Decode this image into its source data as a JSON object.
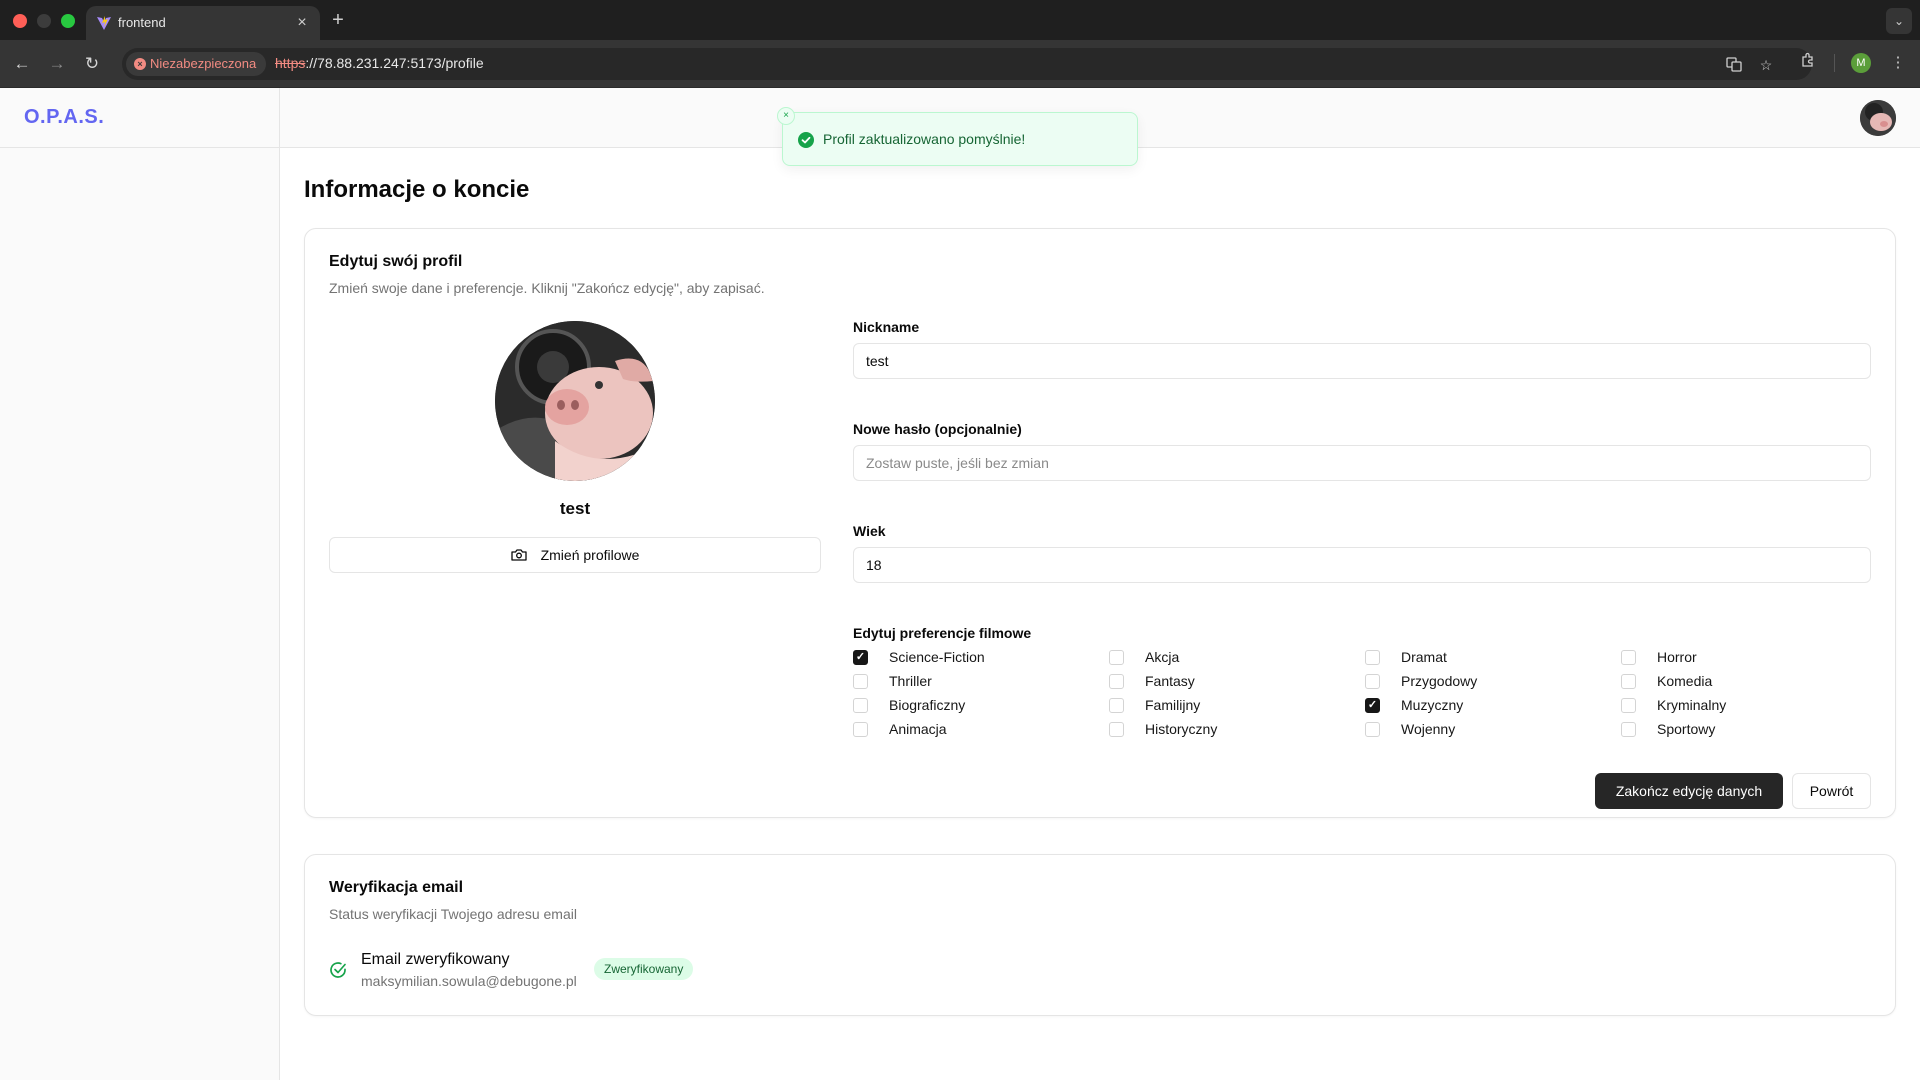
{
  "browser": {
    "tab_title": "frontend",
    "tab_close": "×",
    "new_tab": "+",
    "tab_menu": "⌄",
    "security_label": "Niezabezpieczona",
    "url_scheme": "https",
    "url_rest": "://78.88.231.247:5173/profile",
    "profile_initial": "M"
  },
  "app": {
    "brand": "O.P.A.S.",
    "toast": {
      "message": "Profil zaktualizowano pomyślnie!",
      "close": "×"
    },
    "page_title": "Informacje o koncie",
    "profile_card": {
      "title": "Edytuj swój profil",
      "description": "Zmień swoje dane i preferencje. Kliknij \"Zakończ edycję\", aby zapisać.",
      "display_name": "test",
      "change_photo_label": "Zmień profilowe",
      "fields": {
        "nickname_label": "Nickname",
        "nickname_value": "test",
        "password_label": "Nowe hasło (opcjonalnie)",
        "password_placeholder": "Zostaw puste, jeśli bez zmian",
        "age_label": "Wiek",
        "age_value": "18"
      },
      "genres_label": "Edytuj preferencje filmowe",
      "genres": [
        {
          "label": "Science-Fiction",
          "checked": true
        },
        {
          "label": "Akcja",
          "checked": false
        },
        {
          "label": "Dramat",
          "checked": false
        },
        {
          "label": "Horror",
          "checked": false
        },
        {
          "label": "Thriller",
          "checked": false
        },
        {
          "label": "Fantasy",
          "checked": false
        },
        {
          "label": "Przygodowy",
          "checked": false
        },
        {
          "label": "Komedia",
          "checked": false
        },
        {
          "label": "Biograficzny",
          "checked": false
        },
        {
          "label": "Familijny",
          "checked": false
        },
        {
          "label": "Muzyczny",
          "checked": true
        },
        {
          "label": "Kryminalny",
          "checked": false
        },
        {
          "label": "Animacja",
          "checked": false
        },
        {
          "label": "Historyczny",
          "checked": false
        },
        {
          "label": "Wojenny",
          "checked": false
        },
        {
          "label": "Sportowy",
          "checked": false
        }
      ],
      "save_button": "Zakończ edycję danych",
      "back_button": "Powrót"
    },
    "email_card": {
      "title": "Weryfikacja email",
      "description": "Status weryfikacji Twojego adresu email",
      "status_title": "Email zweryfikowany",
      "email": "maksymilian.sowula@debugone.pl",
      "badge": "Zweryfikowany"
    }
  },
  "colors": {
    "brand": "#6366f1",
    "success": "#16a34a",
    "primary_button": "#262626",
    "insecure": "#f28b82"
  }
}
